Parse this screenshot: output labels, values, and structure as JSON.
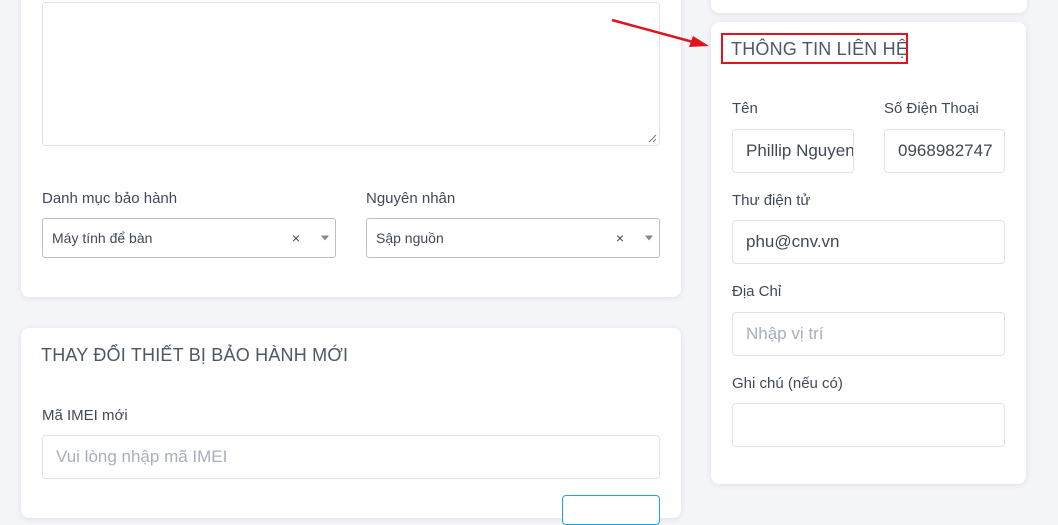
{
  "left_card": {
    "category_label": "Danh mục bảo hành",
    "category_value": "Máy tính để bàn",
    "reason_label": "Nguyên nhân",
    "reason_value": "Sập nguồn",
    "clear_glyph": "×"
  },
  "device_card": {
    "title": "THAY ĐỔI THIẾT BỊ BẢO HÀNH MỚI",
    "imei_label": "Mã IMEI mới",
    "imei_placeholder": "Vui lòng nhập mã IMEI"
  },
  "contact_card": {
    "title": "THÔNG TIN LIÊN HỆ",
    "name_label": "Tên",
    "name_value": "Phillip Nguyen",
    "phone_label": "Số Điện Thoại",
    "phone_value": "0968982747",
    "email_label": "Thư điện tử",
    "email_value": "phu@cnv.vn",
    "address_label": "Địa Chỉ",
    "address_placeholder": "Nhập vị trí",
    "note_label": "Ghi chú (nếu có)",
    "note_value": ""
  },
  "annotation": {
    "color": "#e0141e"
  }
}
